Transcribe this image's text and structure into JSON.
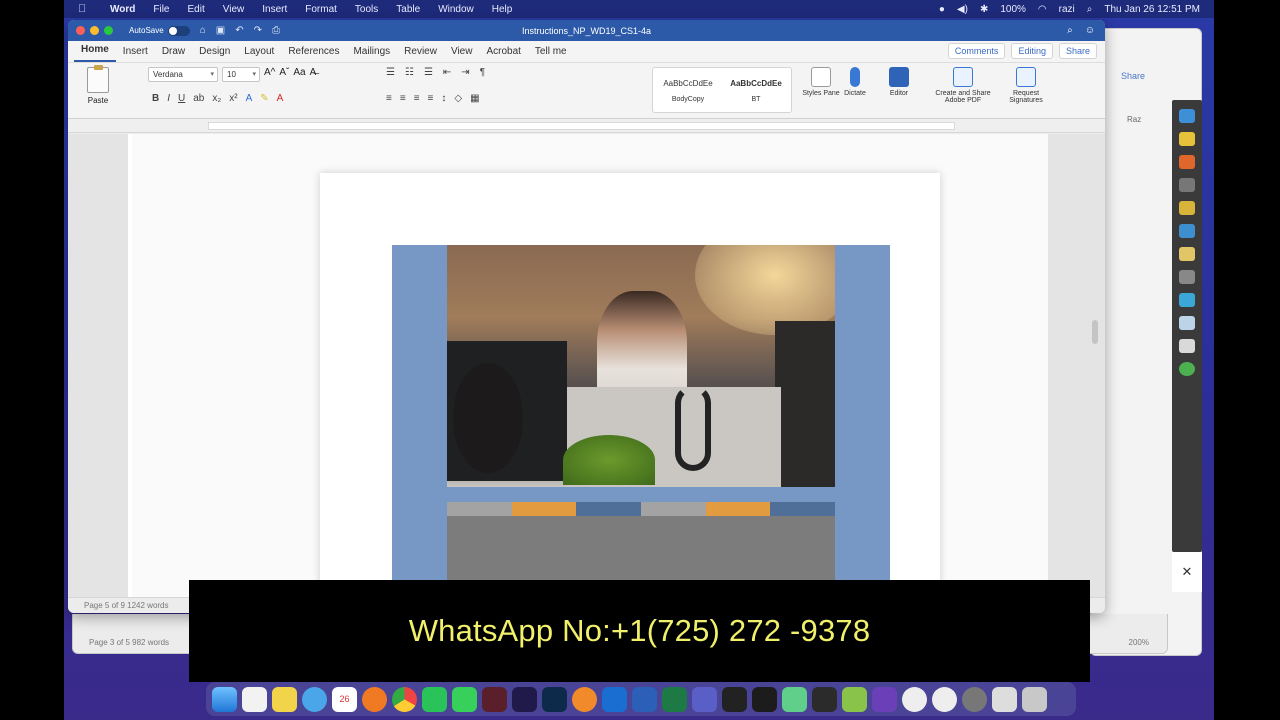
{
  "menubar": {
    "apple": "",
    "items": [
      "Word",
      "File",
      "Edit",
      "View",
      "Insert",
      "Format",
      "Tools",
      "Table",
      "Window",
      "Help"
    ],
    "right": {
      "battery": "100%",
      "user": "razi",
      "datetime": "Thu Jan 26  12:51 PM"
    }
  },
  "word": {
    "autosave_label": "AutoSave",
    "doc_title": "Instructions_NP_WD19_CS1-4a",
    "tabs": [
      "Home",
      "Insert",
      "Draw",
      "Design",
      "Layout",
      "References",
      "Mailings",
      "Review",
      "View",
      "Acrobat",
      "Tell me"
    ],
    "comments": "Comments",
    "editing": "Editing",
    "share": "Share",
    "paste": "Paste",
    "font_name": "Verdana",
    "font_size": "10",
    "styles": [
      {
        "preview": "AaBbCcDdEe",
        "name": "BodyCopy"
      },
      {
        "preview": "AaBbCcDdEe",
        "name": "BT"
      }
    ],
    "styles_pane": "Styles Pane",
    "dictate": "Dictate",
    "editor": "Editor",
    "create_share_pdf": "Create and Share Adobe PDF",
    "request_signatures": "Request Signatures",
    "status": "Page 5 of 9     1242 words"
  },
  "word2": {
    "status": "Page 3 of 5     982 words",
    "zoom": "200%",
    "share": "Share",
    "user": "Raz"
  },
  "banner": {
    "text": "WhatsApp No:+1(725) 272 -9378"
  },
  "colors": {
    "brochure_blue": "#7798c4",
    "bar_grey": "#a3a3a3",
    "bar_orange": "#e39b3f",
    "bar_blue": "#4f6f99",
    "banner_text": "#f1f06a"
  },
  "dock": {
    "apps": [
      "finder",
      "notes",
      "stickies",
      "safari",
      "calendar",
      "firefox",
      "chrome",
      "whatsapp",
      "messages",
      "dreamweaver",
      "premiere",
      "photoshop",
      "blender",
      "outlook",
      "word",
      "excel",
      "teams",
      "unity",
      "terminal",
      "maps",
      "vscode",
      "android",
      "visualstudio",
      "panda1",
      "panda2",
      "settings",
      "preview",
      "trash"
    ]
  },
  "calendar_day": "26"
}
